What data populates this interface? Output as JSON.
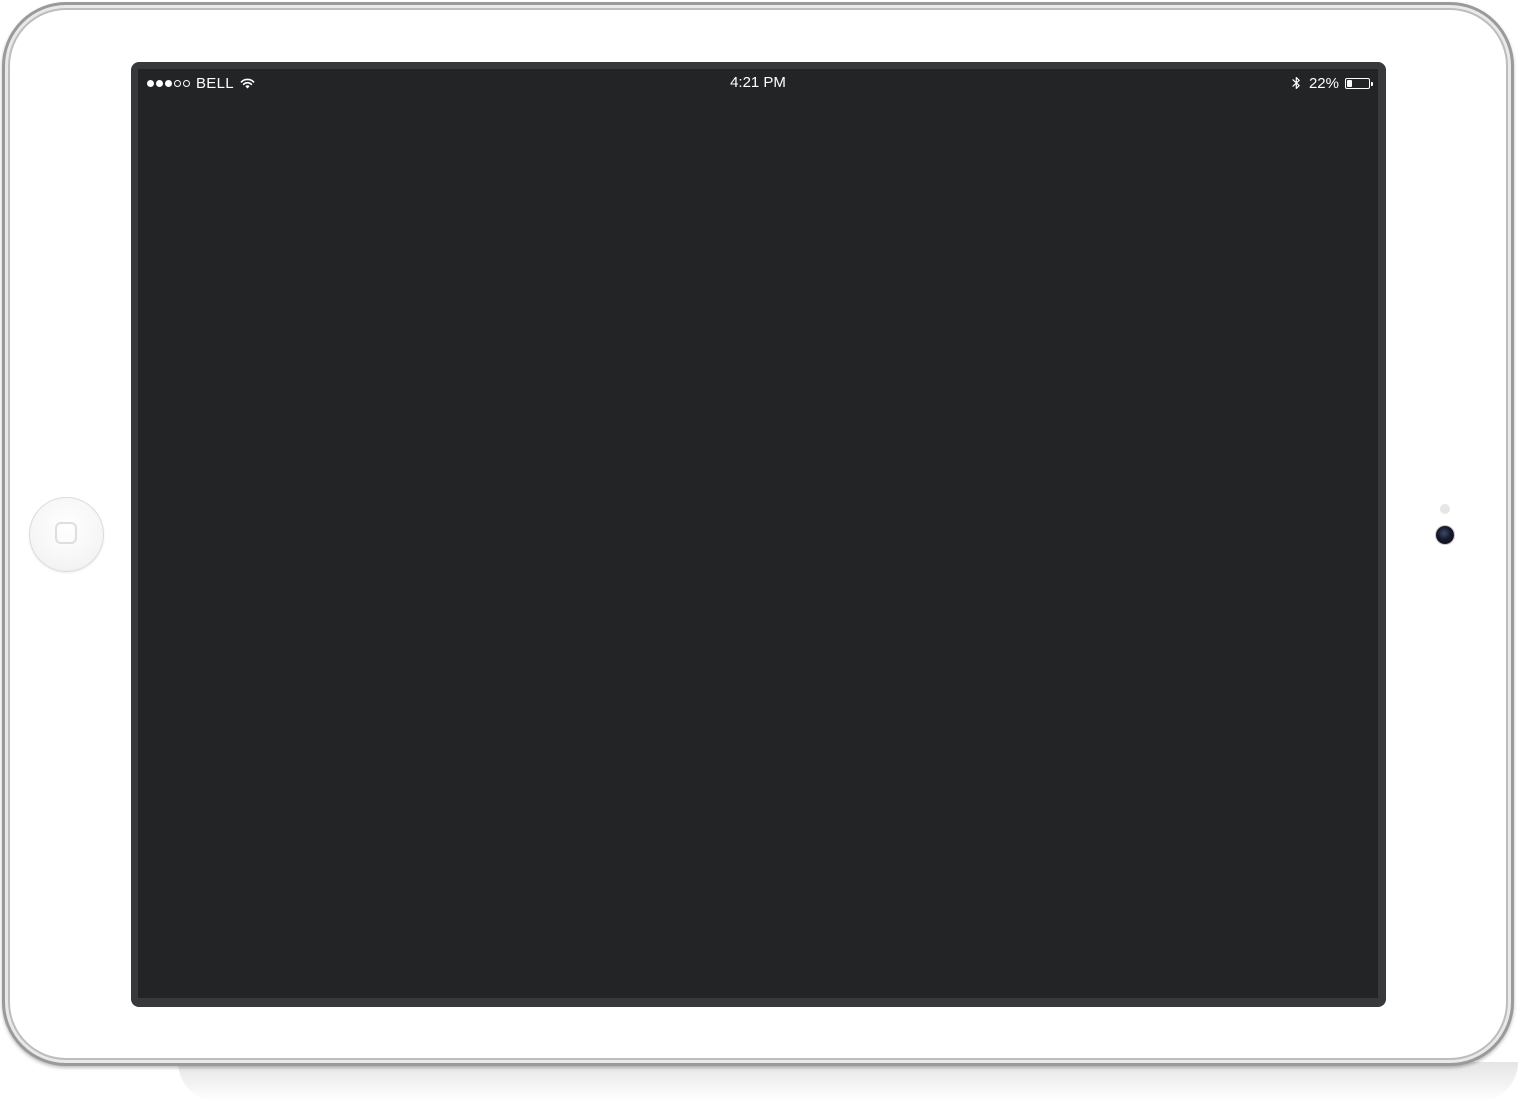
{
  "status_bar": {
    "signal_filled": 3,
    "signal_total": 5,
    "carrier": "BELL",
    "time": "4:21 PM",
    "battery_percent_label": "22%",
    "battery_level": 0.22,
    "icons": {
      "signal": "signal-dots-icon",
      "wifi": "wifi-icon",
      "bluetooth": "bluetooth-icon",
      "battery": "battery-icon"
    }
  },
  "colors": {
    "screen_background": "#232426",
    "bezel": "#38393b",
    "status_text": "#ffffff"
  }
}
